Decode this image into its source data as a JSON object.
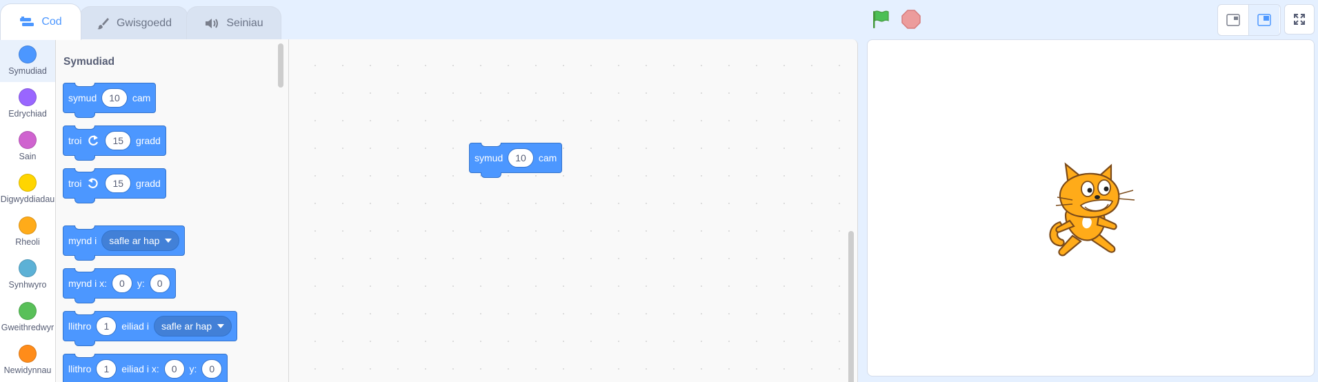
{
  "tabs": [
    {
      "label": "Cod",
      "icon": "code-icon",
      "active": true
    },
    {
      "label": "Gwisgoedd",
      "icon": "brush-icon",
      "active": false
    },
    {
      "label": "Seiniau",
      "icon": "speaker-icon",
      "active": false
    }
  ],
  "controls": {
    "green_flag": "green-flag-icon",
    "stop": "stop-icon",
    "colors": {
      "flag": "#4cbf56",
      "stop": "#ec9c9c"
    }
  },
  "categories": [
    {
      "label": "Symudiad",
      "color": "#4c97ff",
      "active": true
    },
    {
      "label": "Edrychiad",
      "color": "#9966ff",
      "active": false
    },
    {
      "label": "Sain",
      "color": "#cf63cf",
      "active": false
    },
    {
      "label": "Digwyddiadau",
      "color": "#ffd500",
      "active": false
    },
    {
      "label": "Rheoli",
      "color": "#ffab19",
      "active": false
    },
    {
      "label": "Synhwyro",
      "color": "#5cb1d6",
      "active": false
    },
    {
      "label": "Gweithredwyr",
      "color": "#59c059",
      "active": false
    },
    {
      "label": "Newidynnau",
      "color": "#ff8c1a",
      "active": false
    }
  ],
  "flyout": {
    "title": "Symudiad",
    "blocks": {
      "move": {
        "text1": "symud",
        "value": "10",
        "text2": "cam"
      },
      "turn_right": {
        "text1": "troi",
        "icon": "rotate-right-icon",
        "value": "15",
        "text2": "gradd"
      },
      "turn_left": {
        "text1": "troi",
        "icon": "rotate-left-icon",
        "value": "15",
        "text2": "gradd"
      },
      "goto": {
        "text1": "mynd i",
        "dropdown": "safle ar hap"
      },
      "goto_xy": {
        "text1": "mynd i x:",
        "x": "0",
        "ylabel": "y:",
        "y": "0"
      },
      "glide": {
        "text1": "llithro",
        "value": "1",
        "text2": "eiliad i",
        "dropdown": "safle ar hap"
      },
      "glide_xy": {
        "text1": "llithro",
        "value": "1",
        "text2": "eiliad i x:",
        "x": "0",
        "ylabel": "y:",
        "y": "0"
      }
    }
  },
  "workspace": {
    "block": {
      "text1": "symud",
      "value": "10",
      "text2": "cam"
    }
  },
  "stage": {
    "sprite": "cat-sprite"
  }
}
